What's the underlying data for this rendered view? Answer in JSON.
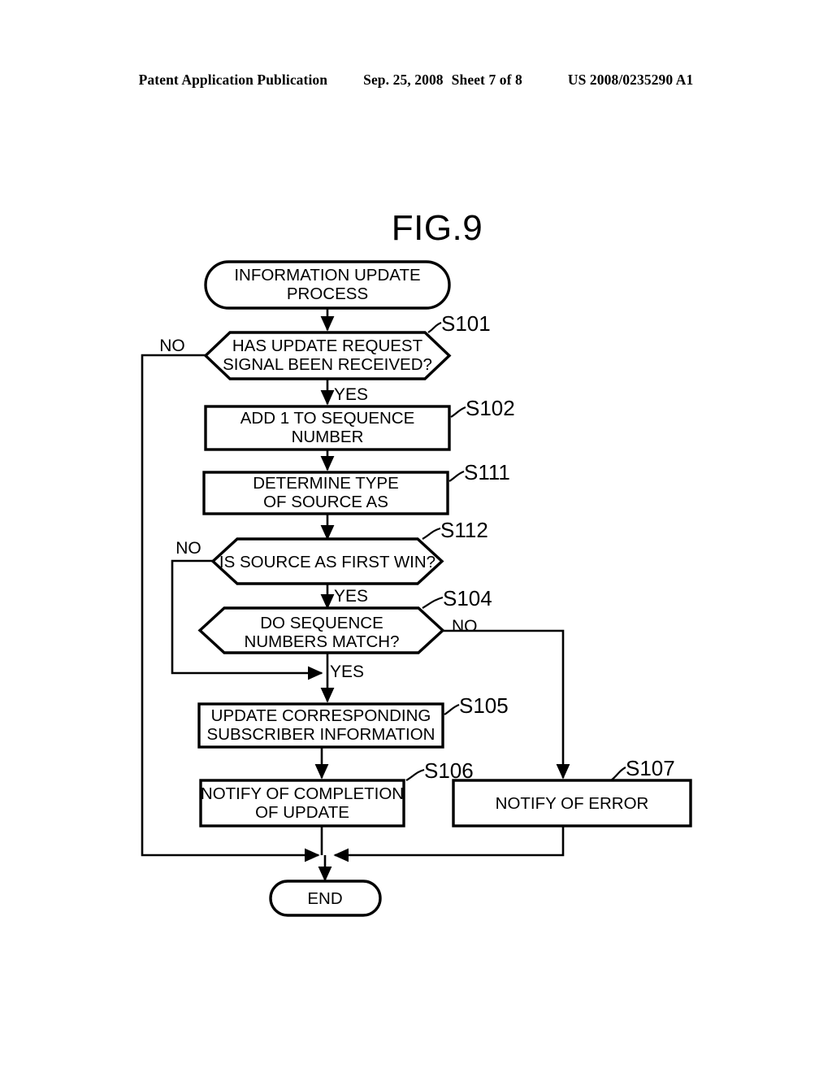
{
  "header": {
    "publication": "Patent Application Publication",
    "date": "Sep. 25, 2008",
    "sheet": "Sheet 7 of 8",
    "patent_number": "US 2008/0235290 A1"
  },
  "figure": {
    "title": "FIG.9"
  },
  "chart_data": {
    "type": "diagram",
    "title": "FIG.9",
    "nodes": [
      {
        "id": "start",
        "label": "INFORMATION UPDATE PROCESS",
        "shape": "terminal",
        "step": ""
      },
      {
        "id": "s101",
        "label": "HAS UPDATE REQUEST SIGNAL BEEN RECEIVED?",
        "shape": "decision",
        "step": "S101"
      },
      {
        "id": "s102",
        "label": "ADD 1 TO SEQUENCE NUMBER",
        "shape": "process",
        "step": "S102"
      },
      {
        "id": "s111",
        "label": "DETERMINE TYPE OF SOURCE AS",
        "shape": "process",
        "step": "S111"
      },
      {
        "id": "s112",
        "label": "IS SOURCE AS FIRST WIN?",
        "shape": "decision",
        "step": "S112"
      },
      {
        "id": "s104",
        "label": "DO SEQUENCE NUMBERS MATCH?",
        "shape": "decision",
        "step": "S104"
      },
      {
        "id": "s105",
        "label": "UPDATE CORRESPONDING SUBSCRIBER INFORMATION",
        "shape": "process",
        "step": "S105"
      },
      {
        "id": "s106",
        "label": "NOTIFY OF COMPLETION OF UPDATE",
        "shape": "process",
        "step": "S106"
      },
      {
        "id": "s107",
        "label": "NOTIFY OF ERROR",
        "shape": "process",
        "step": "S107"
      },
      {
        "id": "end",
        "label": "END",
        "shape": "terminal",
        "step": ""
      }
    ],
    "edges": [
      {
        "from": "start",
        "to": "s101",
        "label": ""
      },
      {
        "from": "s101",
        "to": "end",
        "label": "NO"
      },
      {
        "from": "s101",
        "to": "s102",
        "label": "YES"
      },
      {
        "from": "s102",
        "to": "s111",
        "label": ""
      },
      {
        "from": "s111",
        "to": "s112",
        "label": ""
      },
      {
        "from": "s112",
        "to": "s105",
        "label": "NO"
      },
      {
        "from": "s112",
        "to": "s104",
        "label": "YES"
      },
      {
        "from": "s104",
        "to": "s107",
        "label": "NO"
      },
      {
        "from": "s104",
        "to": "s105",
        "label": "YES"
      },
      {
        "from": "s105",
        "to": "s106",
        "label": ""
      },
      {
        "from": "s106",
        "to": "end",
        "label": ""
      },
      {
        "from": "s107",
        "to": "end",
        "label": ""
      }
    ]
  },
  "nodes": {
    "start": {
      "line1": "INFORMATION UPDATE",
      "line2": "PROCESS"
    },
    "s101": {
      "line1": "HAS UPDATE REQUEST",
      "line2": "SIGNAL BEEN RECEIVED?",
      "step": "S101"
    },
    "s102": {
      "line1": "ADD 1 TO SEQUENCE",
      "line2": "NUMBER",
      "step": "S102"
    },
    "s111": {
      "line1": "DETERMINE TYPE",
      "line2": "OF SOURCE AS",
      "step": "S111"
    },
    "s112": {
      "line1": "IS SOURCE AS FIRST WIN?",
      "line2": "",
      "step": "S112"
    },
    "s104": {
      "line1": "DO SEQUENCE",
      "line2": "NUMBERS MATCH?",
      "step": "S104"
    },
    "s105": {
      "line1": "UPDATE CORRESPONDING",
      "line2": "SUBSCRIBER INFORMATION",
      "step": "S105"
    },
    "s106": {
      "line1": "NOTIFY OF COMPLETION",
      "line2": "OF UPDATE",
      "step": "S106"
    },
    "s107": {
      "line1": "NOTIFY OF ERROR",
      "line2": "",
      "step": "S107"
    },
    "end": {
      "line1": "END",
      "line2": ""
    }
  },
  "branches": {
    "s101_no": "NO",
    "s101_yes": "YES",
    "s112_no": "NO",
    "s112_yes": "YES",
    "s104_no": "NO",
    "s104_yes": "YES"
  }
}
